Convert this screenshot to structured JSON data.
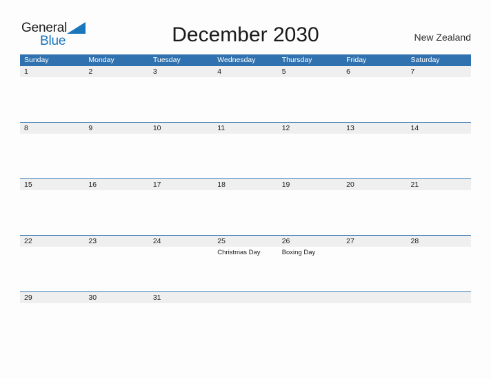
{
  "header": {
    "logo": {
      "word_one": "General",
      "word_two": "Blue",
      "triangle_icon": "triangle-icon",
      "brand_color": "#1c76bc"
    },
    "title": "December 2030",
    "region": "New Zealand"
  },
  "calendar": {
    "colors": {
      "header_blue": "#2f72af",
      "day_band_gray": "#efefef",
      "text": "#1a1a1a",
      "header_text": "#ffffff"
    },
    "weekdays": [
      "Sunday",
      "Monday",
      "Tuesday",
      "Wednesday",
      "Thursday",
      "Friday",
      "Saturday"
    ],
    "weeks": [
      [
        {
          "day": "1",
          "event": ""
        },
        {
          "day": "2",
          "event": ""
        },
        {
          "day": "3",
          "event": ""
        },
        {
          "day": "4",
          "event": ""
        },
        {
          "day": "5",
          "event": ""
        },
        {
          "day": "6",
          "event": ""
        },
        {
          "day": "7",
          "event": ""
        }
      ],
      [
        {
          "day": "8",
          "event": ""
        },
        {
          "day": "9",
          "event": ""
        },
        {
          "day": "10",
          "event": ""
        },
        {
          "day": "11",
          "event": ""
        },
        {
          "day": "12",
          "event": ""
        },
        {
          "day": "13",
          "event": ""
        },
        {
          "day": "14",
          "event": ""
        }
      ],
      [
        {
          "day": "15",
          "event": ""
        },
        {
          "day": "16",
          "event": ""
        },
        {
          "day": "17",
          "event": ""
        },
        {
          "day": "18",
          "event": ""
        },
        {
          "day": "19",
          "event": ""
        },
        {
          "day": "20",
          "event": ""
        },
        {
          "day": "21",
          "event": ""
        }
      ],
      [
        {
          "day": "22",
          "event": ""
        },
        {
          "day": "23",
          "event": ""
        },
        {
          "day": "24",
          "event": ""
        },
        {
          "day": "25",
          "event": "Christmas Day"
        },
        {
          "day": "26",
          "event": "Boxing Day"
        },
        {
          "day": "27",
          "event": ""
        },
        {
          "day": "28",
          "event": ""
        }
      ],
      [
        {
          "day": "29",
          "event": ""
        },
        {
          "day": "30",
          "event": ""
        },
        {
          "day": "31",
          "event": ""
        },
        {
          "day": "",
          "event": ""
        },
        {
          "day": "",
          "event": ""
        },
        {
          "day": "",
          "event": ""
        },
        {
          "day": "",
          "event": ""
        }
      ]
    ]
  }
}
